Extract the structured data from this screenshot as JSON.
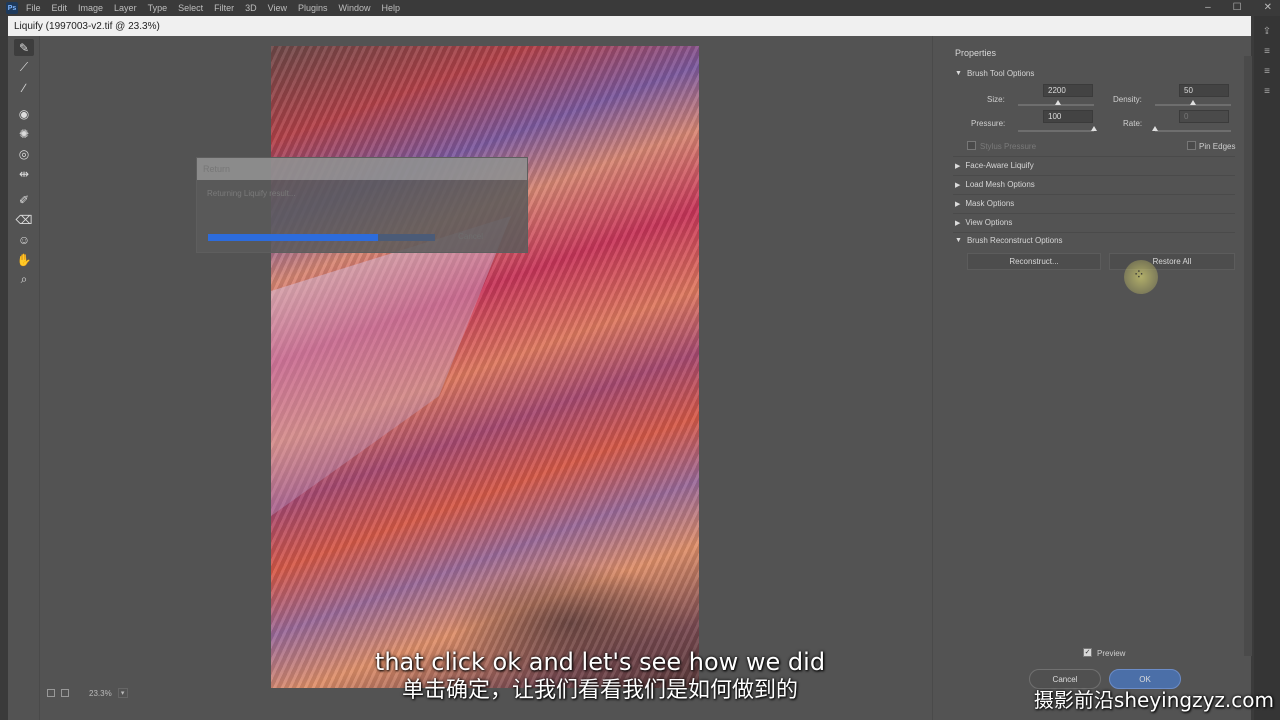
{
  "menubar": {
    "logo": "Ps",
    "items": [
      "File",
      "Edit",
      "Image",
      "Layer",
      "Type",
      "Select",
      "Filter",
      "3D",
      "View",
      "Plugins",
      "Window",
      "Help"
    ],
    "window_controls": [
      "–",
      "☐",
      "✕"
    ]
  },
  "dialog": {
    "title": "Liquify (1997003-v2.tif @ 23.3%)"
  },
  "toolbar": {
    "tools": [
      "forward-warp-icon",
      "reconstruct-icon",
      "smooth-icon",
      "twirl-icon",
      "pucker-icon",
      "bloat-icon",
      "push-left-icon",
      "freeze-mask-icon",
      "thaw-mask-icon",
      "face-icon",
      "hand-icon",
      "zoom-icon"
    ],
    "glyphs": [
      "✎",
      "⟋",
      "∕",
      "◉",
      "✺",
      "◎",
      "⇹",
      "✐",
      "⌫",
      "☺",
      "✋",
      "⌕"
    ]
  },
  "canvas": {
    "zoom": "23.3%",
    "zoom_caret": "▾"
  },
  "progress": {
    "title": "Return",
    "message": "Returning Liquify result...",
    "percent": 0.75,
    "cancel_label": "Cancel"
  },
  "properties": {
    "title": "Properties",
    "brush_tool_options": {
      "label": "Brush Tool Options",
      "size_label": "Size:",
      "size_value": "2200",
      "size_fraction": 0.52,
      "density_label": "Density:",
      "density_value": "50",
      "density_fraction": 0.5,
      "pressure_label": "Pressure:",
      "pressure_value": "100",
      "pressure_fraction": 1.0,
      "rate_label": "Rate:",
      "rate_value": "0",
      "rate_fraction": 0.0,
      "stylus_label": "Stylus Pressure",
      "pin_edges_label": "Pin Edges"
    },
    "sections": [
      "Face-Aware Liquify",
      "Load Mesh Options",
      "Mask Options",
      "View Options"
    ],
    "brush_reconstruct": {
      "label": "Brush Reconstruct Options",
      "reconstruct_label": "Reconstruct...",
      "restore_label": "Restore All"
    },
    "preview_label": "Preview",
    "cancel_label": "Cancel",
    "ok_label": "OK"
  },
  "subtitles": {
    "en": "that click ok and let's see how we did",
    "zh": "单击确定，让我们看看我们是如何做到的"
  },
  "watermark": "摄影前沿sheyingzyz.com"
}
